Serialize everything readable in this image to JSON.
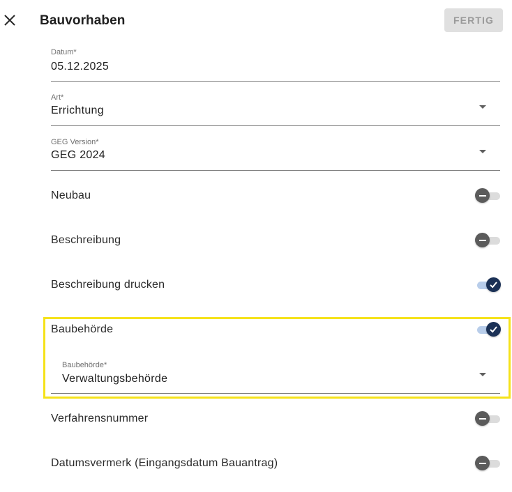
{
  "header": {
    "title": "Bauvorhaben",
    "done_label": "FERTIG",
    "close_icon": "close-icon"
  },
  "fields": {
    "datum": {
      "label": "Datum*",
      "value": "05.12.2025"
    },
    "art": {
      "label": "Art*",
      "value": "Errichtung"
    },
    "geg": {
      "label": "GEG Version*",
      "value": "GEG 2024"
    },
    "baubehoerde": {
      "label": "Baubehörde*",
      "value": "Verwaltungsbehörde"
    }
  },
  "toggles": {
    "neubau": {
      "label": "Neubau",
      "state": "off"
    },
    "beschreibung": {
      "label": "Beschreibung",
      "state": "off"
    },
    "beschreibung_drucken": {
      "label": "Beschreibung drucken",
      "state": "on"
    },
    "baubehoerde": {
      "label": "Baubehörde",
      "state": "on"
    },
    "verfahrensnummer": {
      "label": "Verfahrensnummer",
      "state": "off"
    },
    "datumsvermerk": {
      "label": "Datumsvermerk (Eingangsdatum Bauantrag)",
      "state": "off"
    }
  },
  "colors": {
    "highlight": "#f5e21a",
    "toggle_on_thumb": "#1b3156",
    "toggle_on_track": "#b8cdea",
    "toggle_off_thumb": "#5b5b5b",
    "toggle_off_track": "#dcdcdc"
  }
}
